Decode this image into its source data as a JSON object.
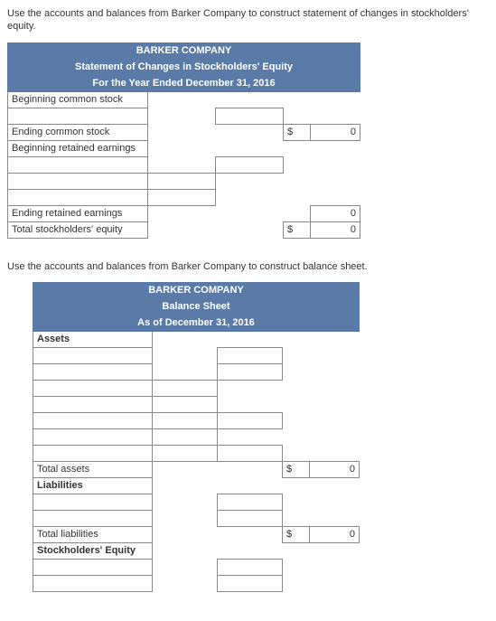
{
  "instructions": {
    "t1": "Use the accounts and balances from Barker Company to construct statement of changes in stockholders' equity.",
    "t2": "Use the accounts and balances from Barker Company to construct balance sheet."
  },
  "t1": {
    "company": "BARKER COMPANY",
    "title": "Statement of Changes in Stockholders' Equity",
    "period": "For the Year Ended December 31, 2016",
    "rows": {
      "beg_cs": "Beginning common stock",
      "end_cs": "Ending common stock",
      "beg_re": "Beginning retained earnings",
      "end_re": "Ending retained earnings",
      "tot_se": "Total stockholders' equity"
    },
    "vals": {
      "end_cs_cur": "$",
      "end_cs_val": "0",
      "end_re_val": "0",
      "tot_se_cur": "$",
      "tot_se_val": "0"
    }
  },
  "t2": {
    "company": "BARKER COMPANY",
    "title": "Balance Sheet",
    "period": "As of December 31, 2016",
    "rows": {
      "assets": "Assets",
      "tot_assets": "Total assets",
      "liab": "Liabilities",
      "tot_liab": "Total liabilities",
      "se": "Stockholders' Equity"
    },
    "vals": {
      "ta_cur": "$",
      "ta_val": "0",
      "tl_cur": "$",
      "tl_val": "0"
    }
  }
}
